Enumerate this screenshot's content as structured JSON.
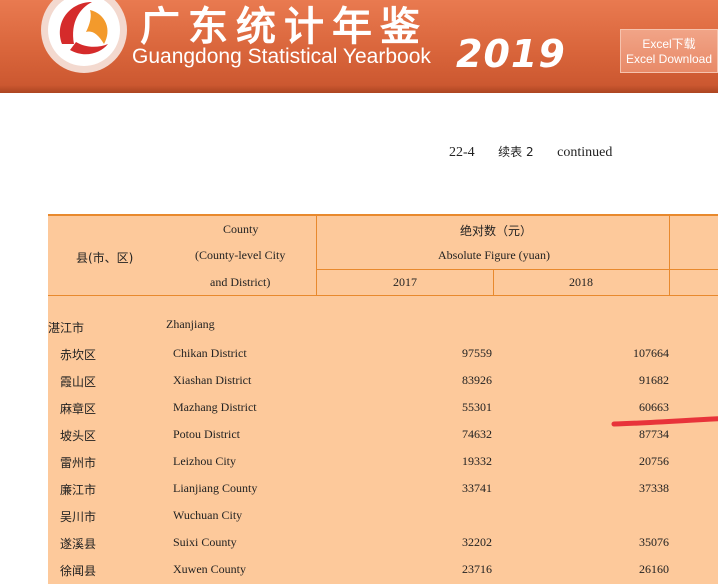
{
  "header": {
    "title_cn": "广东统计年鉴",
    "title_en": "Guangdong Statistical Yearbook",
    "year": "2019",
    "download_button": {
      "line1": "Excel下载",
      "line2": "Excel Download"
    },
    "colors": {
      "banner": "#d9653b",
      "button": "#e88a68"
    }
  },
  "caption": {
    "number": "22-4",
    "cn": "续表 2",
    "en": "continued"
  },
  "table": {
    "colors": {
      "background": "#fdc99b",
      "rule": "#e8892d"
    },
    "headers": {
      "county_cn": "县(市、区)",
      "county_en_1": "County",
      "county_en_2": "(County-level City",
      "county_en_3": "and District)",
      "absolute_cn": "绝对数（元）",
      "absolute_en": "Absolute Figure (yuan)",
      "year_2017": "2017",
      "year_2018": "2018"
    },
    "rows": [
      {
        "cn": "湛江市",
        "en": "Zhanjiang",
        "v2017": "",
        "v2018": ""
      },
      {
        "cn": "赤坎区",
        "en": "Chikan District",
        "v2017": "97559",
        "v2018": "107664"
      },
      {
        "cn": "霞山区",
        "en": "Xiashan District",
        "v2017": "83926",
        "v2018": "91682"
      },
      {
        "cn": "麻章区",
        "en": "Mazhang District",
        "v2017": "55301",
        "v2018": "60663"
      },
      {
        "cn": "坡头区",
        "en": "Potou District",
        "v2017": "74632",
        "v2018": "87734"
      },
      {
        "cn": "雷州市",
        "en": "Leizhou City",
        "v2017": "19332",
        "v2018": "20756"
      },
      {
        "cn": "廉江市",
        "en": "Lianjiang County",
        "v2017": "33741",
        "v2018": "37338"
      },
      {
        "cn": "吴川市",
        "en": "Wuchuan City",
        "v2017": "",
        "v2018": ""
      },
      {
        "cn": "遂溪县",
        "en": "Suixi County",
        "v2017": "32202",
        "v2018": "35076"
      },
      {
        "cn": "徐闻县",
        "en": "Xuwen County",
        "v2017": "23716",
        "v2018": "26160"
      }
    ]
  }
}
